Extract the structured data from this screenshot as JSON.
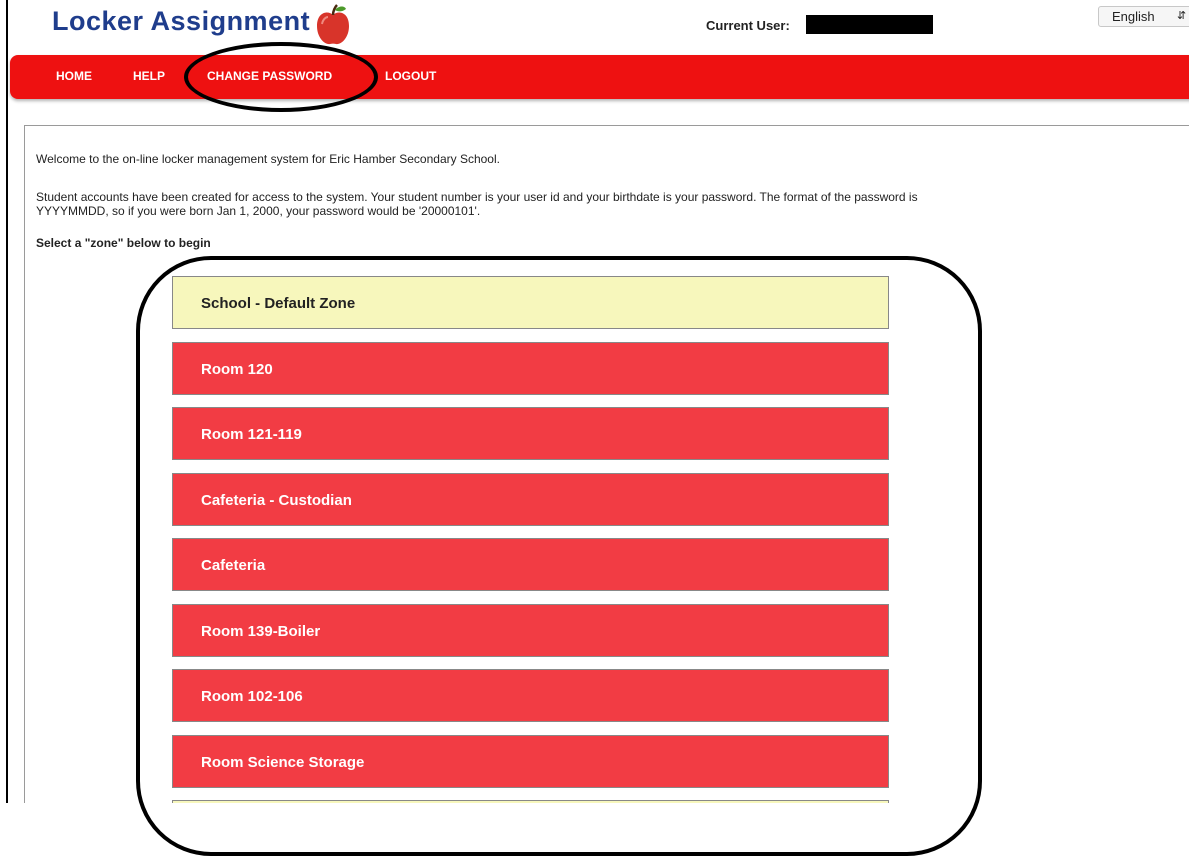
{
  "header": {
    "app_title": "Locker Assignment",
    "user_label": "Current User:",
    "language": "English",
    "brand_color": "#1f3d8c",
    "logo_icon": "apple-icon"
  },
  "nav": {
    "color": "#ee1111",
    "items": [
      {
        "label": "HOME"
      },
      {
        "label": "HELP"
      },
      {
        "label": "CHANGE PASSWORD"
      },
      {
        "label": "LOGOUT"
      }
    ]
  },
  "content": {
    "welcome": "Welcome to the on-line locker management system for Eric Hamber Secondary School.",
    "accounts_line1": "Student accounts have been created for access to the system. Your student number is your user id and your birthdate is your password. The format of the password is",
    "accounts_line2": "YYYYMMDD, so if you were born Jan 1, 2000, your password would be '20000101'.",
    "instruction": "Select a \"zone\" below to begin"
  },
  "zones": [
    {
      "label": "School - Default Zone",
      "color": "#f7f7bc"
    },
    {
      "label": "Room 120",
      "color": "#f23c44"
    },
    {
      "label": "Room 121-119",
      "color": "#f23c44"
    },
    {
      "label": "Cafeteria - Custodian",
      "color": "#f23c44"
    },
    {
      "label": "Cafeteria",
      "color": "#f23c44"
    },
    {
      "label": "Room 139-Boiler",
      "color": "#f23c44"
    },
    {
      "label": "Room 102-106",
      "color": "#f23c44"
    },
    {
      "label": "Room Science Storage",
      "color": "#f23c44"
    }
  ]
}
